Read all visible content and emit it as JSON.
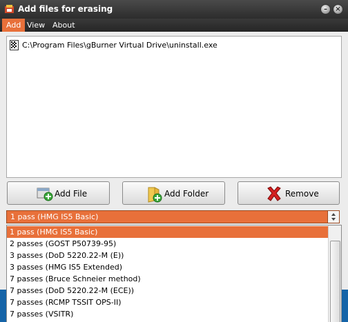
{
  "window": {
    "title": "Add files for erasing"
  },
  "menu": {
    "items": [
      "Add",
      "View",
      "About"
    ],
    "active": "Add"
  },
  "files": [
    {
      "path": "C:\\Program Files\\gBurner Virtual Drive\\uninstall.exe",
      "icon": "executable-file-icon"
    }
  ],
  "buttons": {
    "add_file": "Add File",
    "add_folder": "Add Folder",
    "remove": "Remove"
  },
  "method": {
    "selected": "1 pass (HMG IS5 Basic)",
    "options": [
      "1 pass (HMG IS5 Basic)",
      "2 passes (GOST P50739-95)",
      "3 passes (DoD 5220.22-M (E))",
      "3 passes (HMG IS5 Extended)",
      "7 passes (Bruce Schneier method)",
      "7 passes (DoD 5220.22-M (ECE))",
      "7 passes (RCMP TSSIT OPS-II)",
      "7 passes (VSITR)"
    ]
  },
  "colors": {
    "accent": "#e8703a",
    "titlebar": "#2c2c2c",
    "background_blue": "#1564a8"
  }
}
